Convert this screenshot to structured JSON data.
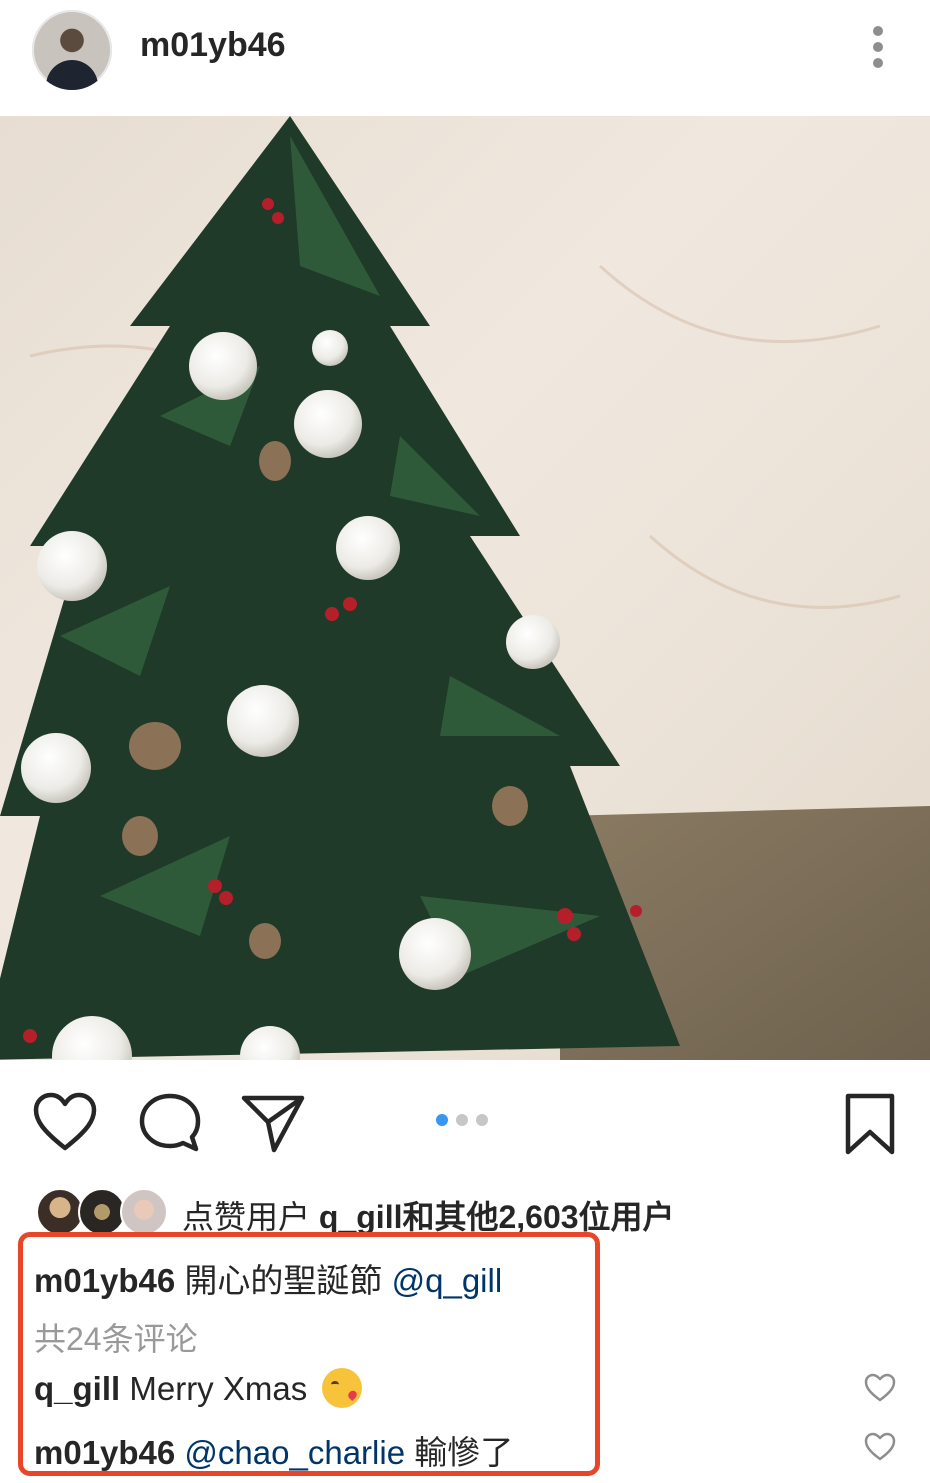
{
  "header": {
    "username": "m01yb46"
  },
  "icons": {
    "more": "vertical-dots-icon",
    "like": "heart-icon",
    "comment": "comment-bubble-icon",
    "share": "paper-plane-icon",
    "save": "bookmark-icon"
  },
  "carousel": {
    "count": 3,
    "active_index": 0,
    "active_color": "#3897f0"
  },
  "likes": {
    "prefix": "点赞用户 ",
    "text": "q_gill和其他2,603位用户"
  },
  "caption": {
    "username": "m01yb46",
    "text": " 開心的聖誕節 ",
    "mention": "@q_gill"
  },
  "view_comments": "共24条评论",
  "comments": [
    {
      "username": "q_gill",
      "text": " Merry Xmas ",
      "emoji": "kissing-face-emoji"
    },
    {
      "username": "m01yb46",
      "mention": " @chao_charlie",
      "text": " 輸慘了"
    }
  ],
  "colors": {
    "highlight": "#e8462a",
    "mention": "#003569",
    "muted": "#999999"
  }
}
